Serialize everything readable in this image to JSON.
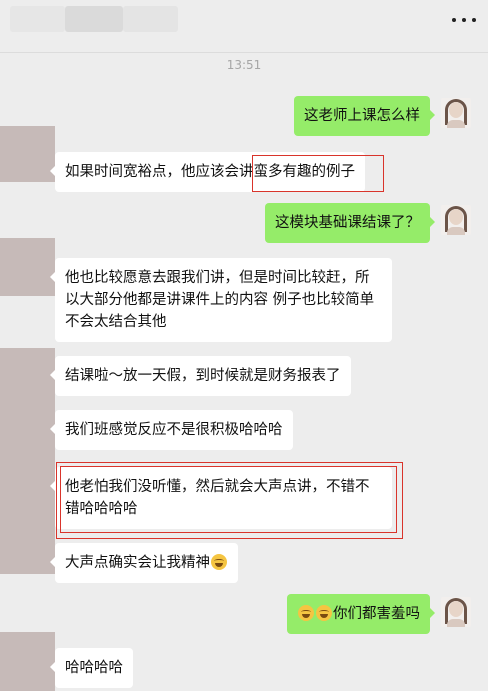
{
  "timestamp": "13:51",
  "messages": [
    {
      "side": "right",
      "text": "这老师上课怎么样"
    },
    {
      "side": "left",
      "text": "如果时间宽裕点，他应该会讲蛮多有趣的例子"
    },
    {
      "side": "right",
      "text": "这模块基础课结课了？"
    },
    {
      "side": "left",
      "lines": [
        "他也比较愿意去跟我们讲，但是时间比较赶，所",
        "以大部分他都是讲课件上的内容 例子也比较简单",
        "不会太结合其他"
      ]
    },
    {
      "side": "left",
      "text": "结课啦～放一天假，到时候就是财务报表了"
    },
    {
      "side": "left",
      "text": "我们班感觉反应不是很积极哈哈哈"
    },
    {
      "side": "left",
      "lines": [
        "他老怕我们没听懂，然后就会大声点讲，不错不",
        "错哈哈哈哈"
      ]
    },
    {
      "side": "left",
      "text": "大声点确实会让我精神",
      "emoji": "laughing-tears-emoji"
    },
    {
      "side": "right",
      "text": "你们都害羞吗",
      "emoji_prefix": [
        "laughing-tears-emoji",
        "laughing-tears-emoji"
      ]
    },
    {
      "side": "left",
      "text": "哈哈哈哈"
    }
  ],
  "colors": {
    "background": "#ededed",
    "sent_bubble": "#95ec69",
    "received_bubble": "#ffffff",
    "highlight_box": "#d9342b"
  },
  "icons": {
    "menu": "more-dots-icon",
    "emoji": "laughing-tears-emoji"
  }
}
